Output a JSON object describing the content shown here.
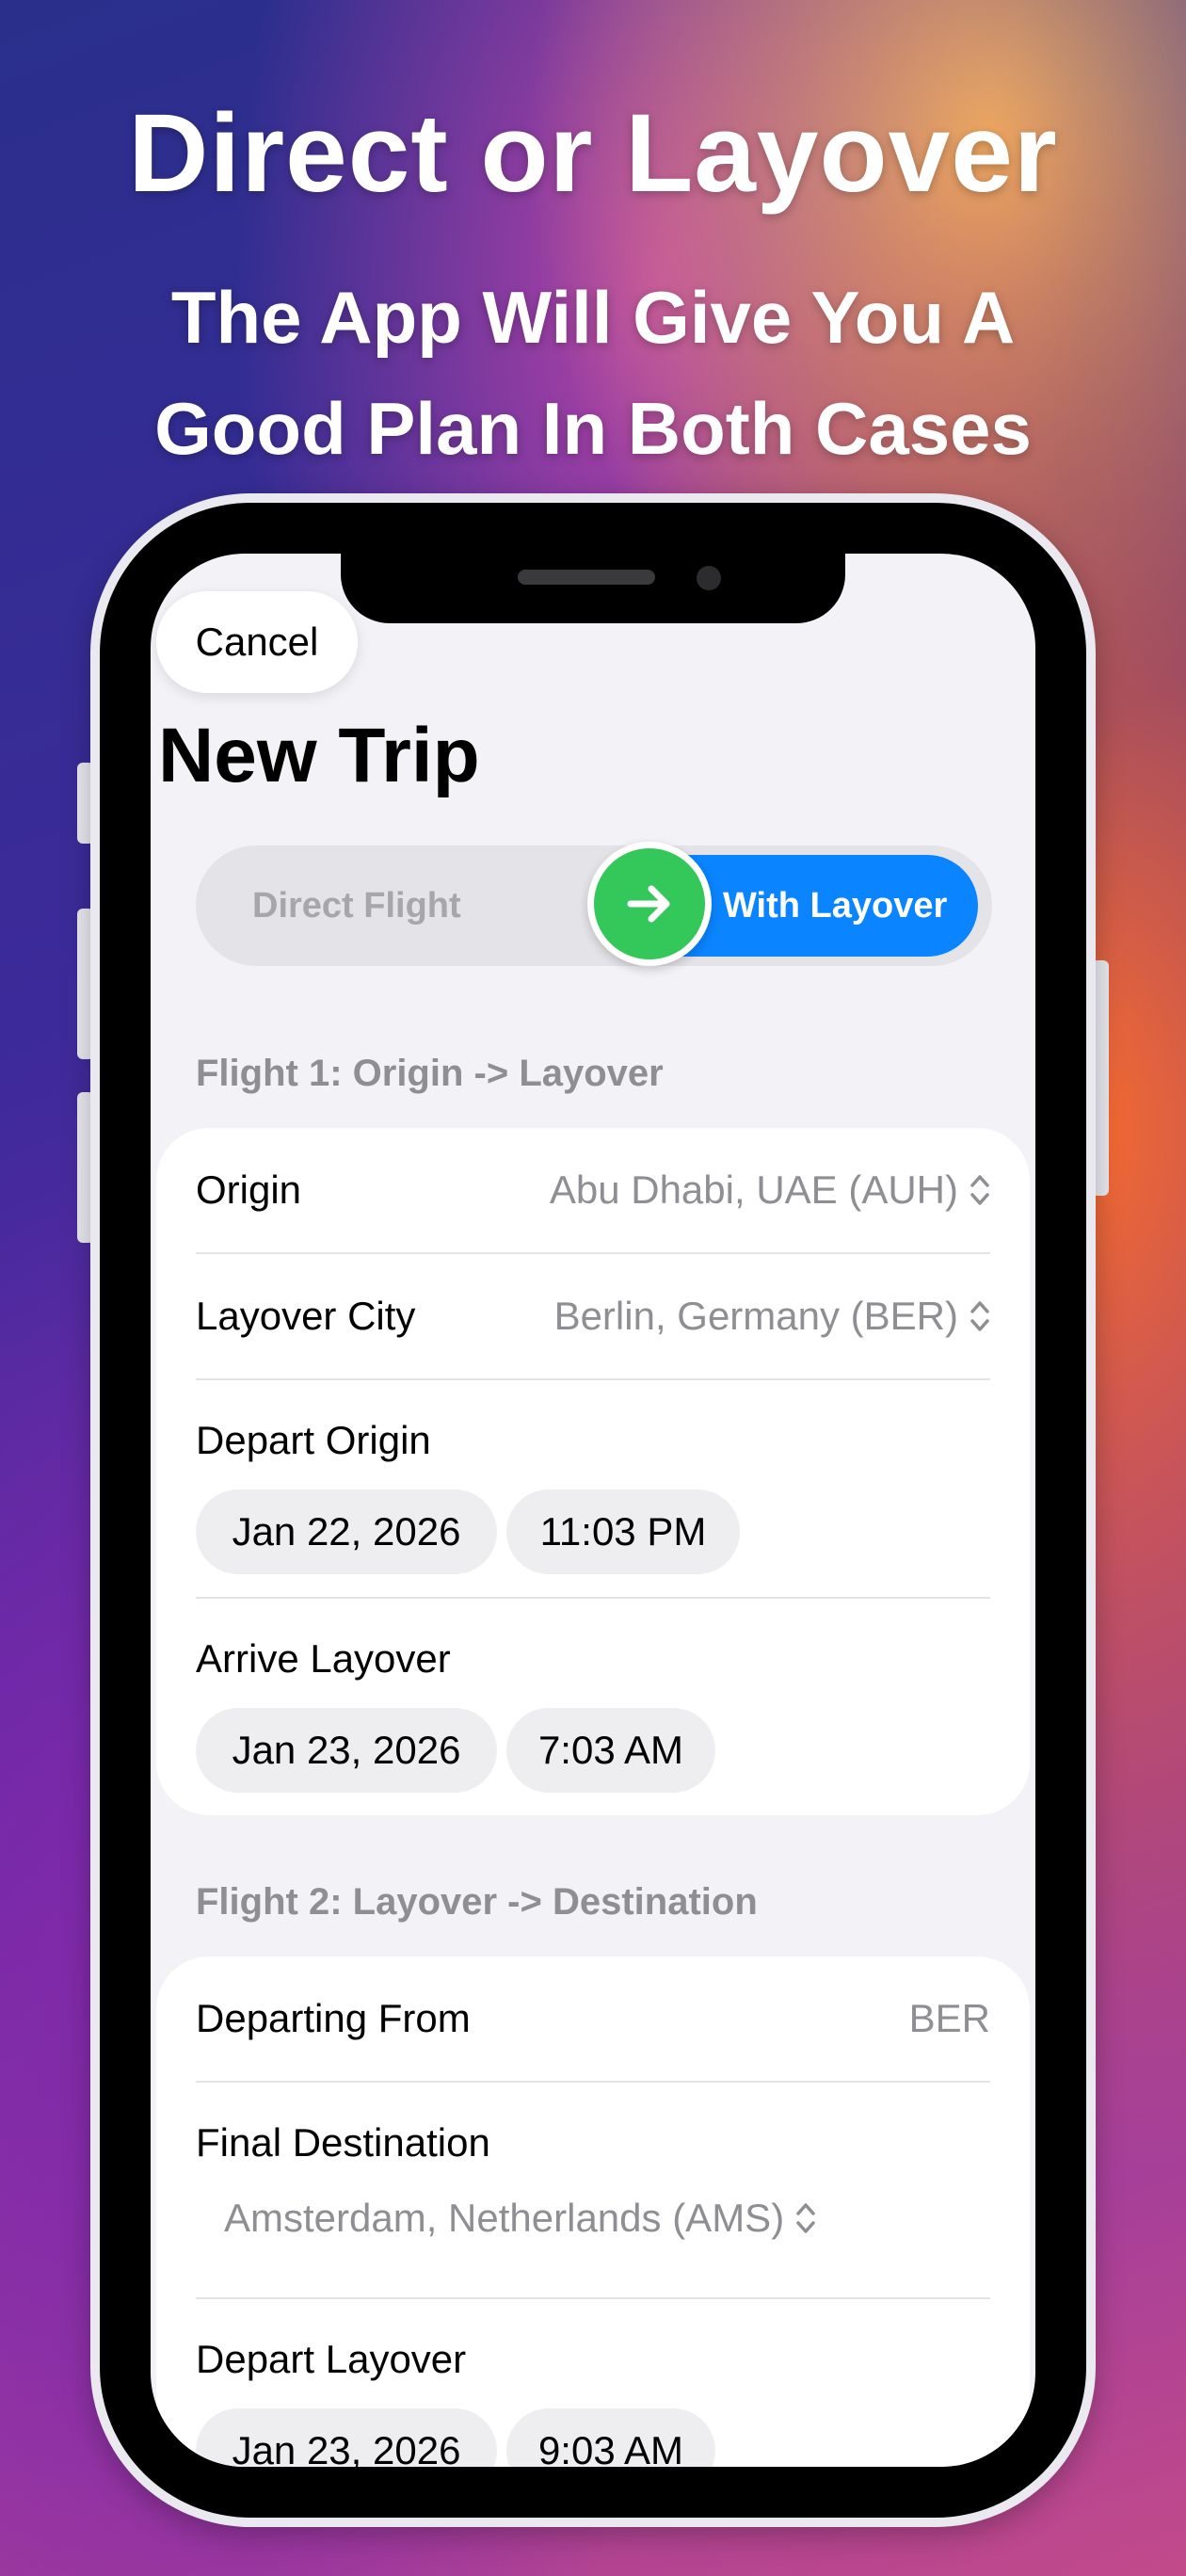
{
  "promo": {
    "headline": "Direct or Layover",
    "subline_1": "The App Will Give You A",
    "subline_2": "Good Plan In Both Cases"
  },
  "nav": {
    "cancel_label": "Cancel",
    "title": "New Trip"
  },
  "trip_type": {
    "options": [
      "Direct Flight",
      "With Layover"
    ],
    "selected": "With Layover",
    "toggle_icon": "arrow-right-icon",
    "colors": {
      "active": "#0a84ff",
      "toggle": "#34c759"
    }
  },
  "flight1": {
    "header": "Flight 1: Origin -> Layover",
    "origin_label": "Origin",
    "origin_value": "Abu Dhabi, UAE (AUH)",
    "layover_label": "Layover City",
    "layover_value": "Berlin, Germany (BER)",
    "depart_label": "Depart Origin",
    "depart_date": "Jan 22, 2026",
    "depart_time": "11:03 PM",
    "arrive_label": "Arrive Layover",
    "arrive_date": "Jan 23, 2026",
    "arrive_time": "7:03 AM"
  },
  "flight2": {
    "header": "Flight 2: Layover -> Destination",
    "departing_label": "Departing From",
    "departing_value": "BER",
    "destination_label": "Final Destination",
    "destination_value": "Amsterdam, Netherlands (AMS)",
    "depart_label": "Depart Layover",
    "depart_date": "Jan 23, 2026",
    "depart_time": "9:03 AM"
  }
}
